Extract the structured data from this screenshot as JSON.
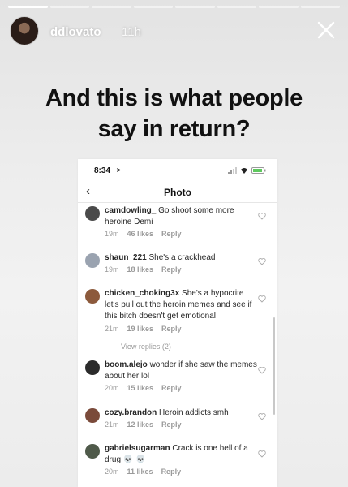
{
  "story": {
    "progress_total": 8,
    "progress_done": 1,
    "username": "ddlovato",
    "time_ago": "11h",
    "caption_line1": "And this is what people",
    "caption_line2": "say in return?"
  },
  "screenshot": {
    "status_time": "8:34",
    "nav_title": "Photo",
    "view_replies": "View replies (2)",
    "reply_label": "Reply",
    "comments": [
      {
        "user": "camdowling_",
        "text": "Go shoot some more heroine Demi",
        "time": "19m",
        "likes": "46 likes",
        "avatar_color": "#4a4a4a"
      },
      {
        "user": "shaun_221",
        "text": "She's a crackhead",
        "time": "19m",
        "likes": "18 likes",
        "avatar_color": "#9aa3b0"
      },
      {
        "user": "chicken_choking3x",
        "text": "She's a hypocrite let's pull out the heroin memes and see if this bitch doesn't get emotional",
        "time": "21m",
        "likes": "19 likes",
        "avatar_color": "#8c5a3c"
      },
      {
        "user": "boom.alejo",
        "text": "wonder if she saw the memes about her lol",
        "time": "20m",
        "likes": "15 likes",
        "avatar_color": "#2b2b2b"
      },
      {
        "user": "cozy.brandon",
        "text": "Heroin addicts smh",
        "time": "21m",
        "likes": "12 likes",
        "avatar_color": "#7a4a3a"
      },
      {
        "user": "gabrielsugarman",
        "text": "Crack is one hell of a drug 💀 💀",
        "time": "20m",
        "likes": "11 likes",
        "avatar_color": "#4f5a4a"
      }
    ]
  }
}
